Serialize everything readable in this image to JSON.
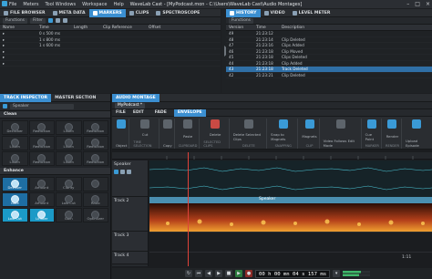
{
  "app": {
    "title": "WaveLab Cast - [MyPodcast.mon - C:\\Users\\WaveLab Cast\\Audio Montages]",
    "menu": [
      "File",
      "Meters",
      "Tool Windows",
      "Workspace",
      "Help"
    ]
  },
  "top_left_panel": {
    "tabs": [
      "FILE BROWSER",
      "META DATA",
      "MARKERS",
      "CLIPS",
      "SPECTROSCOPE"
    ],
    "active_tab": "MARKERS",
    "toolbar": [
      "Functions",
      "Filter"
    ],
    "columns": [
      "Name",
      "Time",
      "Length",
      "Clip Reference",
      "Offset"
    ],
    "rows": [
      {
        "name": "",
        "time": "0 s 500 ms"
      },
      {
        "name": "",
        "time": "1 s 800 ms"
      },
      {
        "name": "",
        "time": "1 s 600 ms"
      },
      {
        "name": "",
        "time": ""
      },
      {
        "name": "",
        "time": ""
      },
      {
        "name": "",
        "time": ""
      }
    ]
  },
  "top_right_panel": {
    "tabs": [
      "HISTORY",
      "VIDEO",
      "LEVEL METER"
    ],
    "active_tab": "HISTORY",
    "toolbar": [
      "Functions"
    ],
    "columns": [
      "Version",
      "Time",
      "Description"
    ],
    "rows": [
      {
        "version": "49",
        "time": "21:23:12",
        "description": ""
      },
      {
        "version": "48",
        "time": "21:23:14",
        "description": "Clip Deleted"
      },
      {
        "version": "47",
        "time": "21:23:16",
        "description": "Clips Added"
      },
      {
        "version": "46",
        "time": "21:23:18",
        "description": "Clip Moved"
      },
      {
        "version": "45",
        "time": "21:23:18",
        "description": "Clips Deleted"
      },
      {
        "version": "44",
        "time": "21:23:18",
        "description": "Clip Added"
      },
      {
        "version": "43",
        "time": "21:23:18",
        "description": "Track Deleted"
      },
      {
        "version": "42",
        "time": "21:23:21",
        "description": "Clip Deleted"
      }
    ]
  },
  "inspector": {
    "tabs": [
      "TRACK INSPECTOR",
      "MASTER SECTION"
    ],
    "track_name": "Speaker",
    "sections": [
      {
        "title": "Clean",
        "knobs": [
          "Declicker",
          "Reduction",
          "Listen",
          "Reduction",
          "Listen",
          "Reduction",
          "Listen",
          "Reduction",
          "Listen",
          "Reduction",
          "Listen",
          "Reduction"
        ]
      },
      {
        "title": "Enhance",
        "knobs": [
          "DeEsser",
          "Amount",
          "Clarity",
          "",
          "Gate",
          "Amount",
          "Low Cut",
          "Ratio",
          "Low Cut",
          "Limiter",
          "Gain",
          "Optimizer"
        ]
      }
    ]
  },
  "montage": {
    "tabs": [
      "AUDIO MONTAGE"
    ],
    "file_tab": "MyPodcast *",
    "ribbon_tabs": [
      "FILE",
      "EDIT",
      "FADE",
      "ENVELOPE"
    ],
    "active_ribbon_tab": "ENVELOPE",
    "ribbon_groups": [
      {
        "label": "Object",
        "cap": ""
      },
      {
        "label": "Cut",
        "cap": "TIME SELECTION"
      },
      {
        "label": "Copy",
        "cap": ""
      },
      {
        "label": "Paste",
        "cap": "CLIPBOARD"
      },
      {
        "label": "Delete",
        "cap": "SELECTED CLIPS"
      },
      {
        "label": "Delete Selected Clips",
        "cap": "DELETE"
      },
      {
        "label": "Snap to Magnets",
        "cap": "SNAPPING"
      },
      {
        "label": "Magnets",
        "cap": "CLIP"
      },
      {
        "label": "Video Follows Edit Mode",
        "cap": "MARKER"
      },
      {
        "label": "Cue Point",
        "cap": "MARKER"
      },
      {
        "label": "Render",
        "cap": "RENDER"
      },
      {
        "label": "Upload Episode",
        "cap": "UPLOAD"
      }
    ],
    "tracks": [
      {
        "name": "Speaker"
      },
      {
        "name": "Track 2"
      },
      {
        "name": "Track 3"
      },
      {
        "name": "Track 4"
      }
    ],
    "clip_label": "Speaker",
    "time_readout": "00 h 00 mn 04 s 157 ms",
    "zoom_readout": "1:11"
  },
  "colors": {
    "accent": "#3b8fd1",
    "wave": "#4cc7d8",
    "playhead": "#e0423a"
  }
}
